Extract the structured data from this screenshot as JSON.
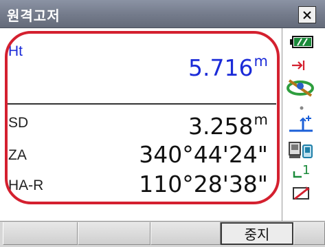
{
  "window": {
    "title": "원격고저"
  },
  "measurements": {
    "ht": {
      "label": "Ht",
      "value": "5.716",
      "unit": "m"
    },
    "sd": {
      "label": "SD",
      "value": "3.258",
      "unit": "m"
    },
    "za": {
      "label": "ZA",
      "value": "340°44'24\""
    },
    "har": {
      "label": "HA-R",
      "value": "110°28'38\""
    }
  },
  "status_icons": {
    "battery": "battery-icon",
    "target": "target-icon",
    "signal": "signal-icon",
    "tilt": "tilt-icon",
    "level": "level-icon",
    "interface": "interface-icon",
    "mode_text": "1",
    "input": "input-mode-icon"
  },
  "softkeys": [
    "",
    "",
    "",
    "중지",
    ""
  ],
  "colors": {
    "highlight_outline": "#d4202f",
    "value_blue": "#1b2bd8",
    "titlebar": "#737a8a"
  }
}
